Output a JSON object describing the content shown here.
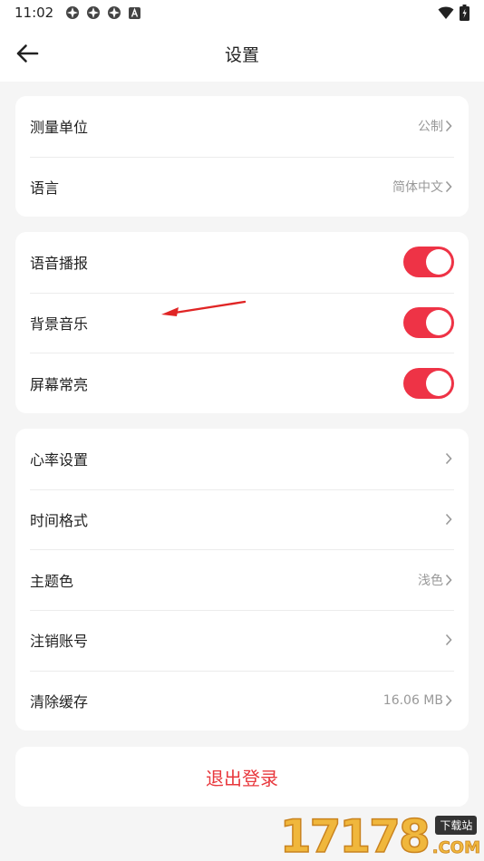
{
  "status": {
    "time": "11:02"
  },
  "header": {
    "title": "设置"
  },
  "units_card": {
    "items": [
      {
        "label": "测量单位",
        "value": "公制"
      },
      {
        "label": "语言",
        "value": "简体中文"
      }
    ]
  },
  "toggles_card": {
    "items": [
      {
        "label": "语音播报",
        "on": true
      },
      {
        "label": "背景音乐",
        "on": true
      },
      {
        "label": "屏幕常亮",
        "on": true
      }
    ]
  },
  "misc_card": {
    "items": [
      {
        "label": "心率设置",
        "value": ""
      },
      {
        "label": "时间格式",
        "value": ""
      },
      {
        "label": "主题色",
        "value": "浅色"
      },
      {
        "label": "注销账号",
        "value": ""
      },
      {
        "label": "清除缓存",
        "value": "16.06 MB"
      }
    ]
  },
  "logout": {
    "label": "退出登录"
  },
  "colors": {
    "accent": "#ee3346",
    "logout_text": "#e8383d"
  },
  "watermark": {
    "number": "17178",
    "tag": "下载站",
    "domain": ".COM"
  }
}
